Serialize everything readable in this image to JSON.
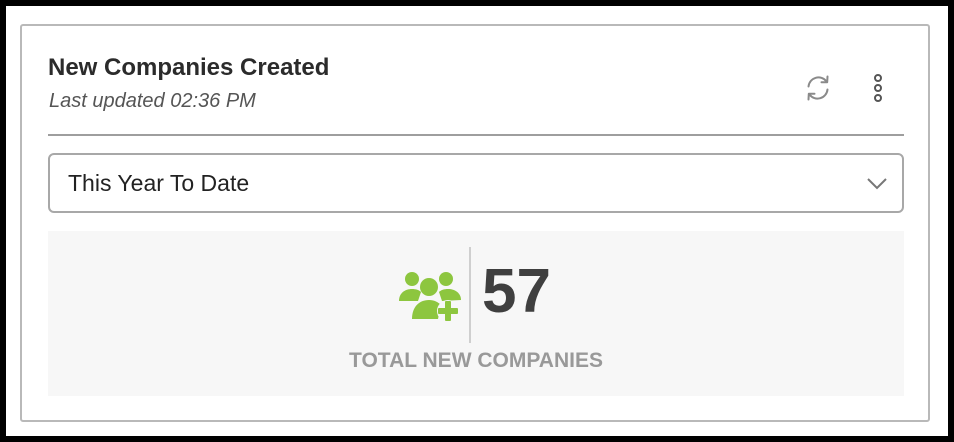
{
  "widget": {
    "title": "New Companies Created",
    "last_updated": "Last updated 02:36 PM",
    "refresh_icon": "refresh-icon",
    "menu_icon": "more-vertical-icon"
  },
  "period_select": {
    "selected": "This Year To Date",
    "chevron_icon": "chevron-down-icon"
  },
  "stat": {
    "icon": "add-users-icon",
    "icon_color": "#8dc63f",
    "value": "57",
    "label": "TOTAL NEW COMPANIES"
  }
}
